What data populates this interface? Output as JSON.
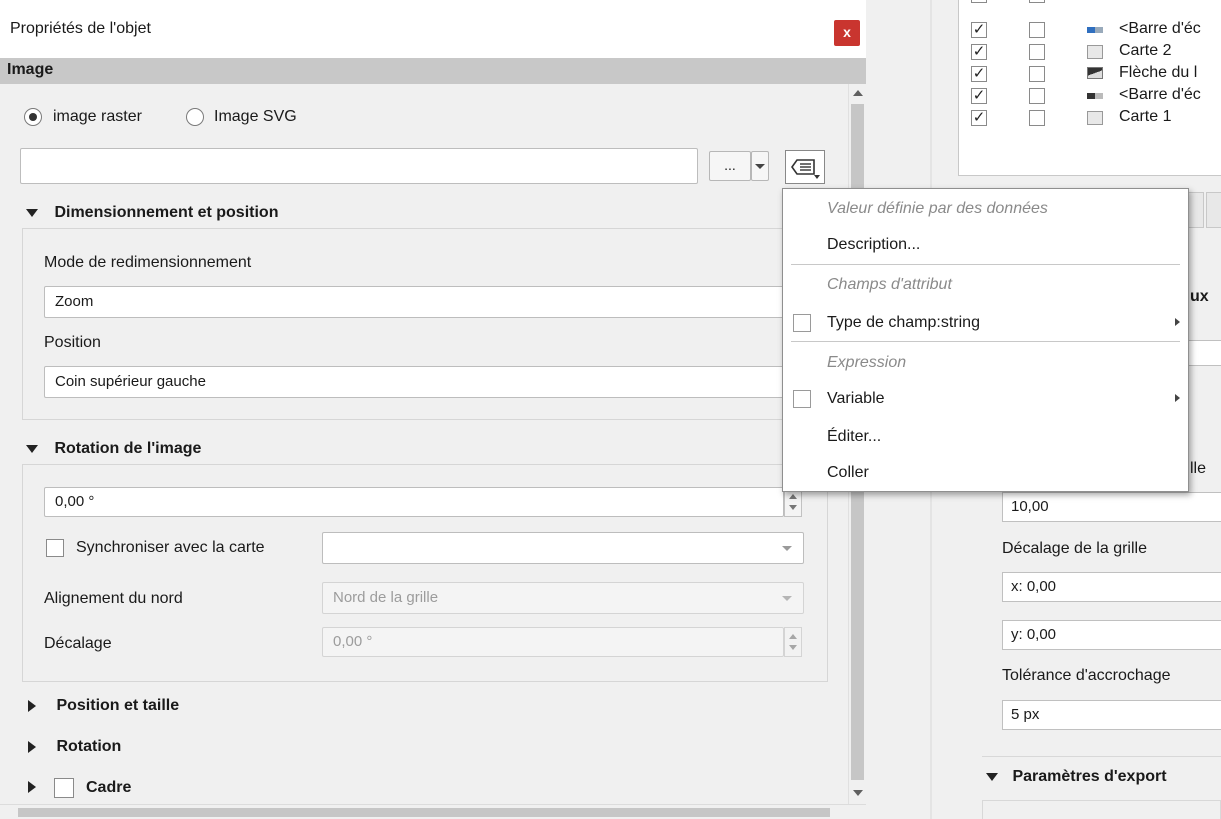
{
  "dialog": {
    "title": "Propriétés de l'objet",
    "close_label": "x",
    "section_title": "Image",
    "radio": {
      "raster_label": "image raster",
      "svg_label": "Image SVG"
    },
    "path_value": "",
    "browse_label": "...",
    "sizing_group": {
      "title": "Dimensionnement et position",
      "resize_mode_label": "Mode de redimensionnement",
      "resize_mode_value": "Zoom",
      "position_label": "Position",
      "position_value": "Coin supérieur gauche"
    },
    "rotation_group": {
      "title": "Rotation de l'image",
      "rotation_value": "0,00 °",
      "sync_label": "Synchroniser avec la carte",
      "sync_value": "",
      "north_label": "Alignement du nord",
      "north_value": "Nord de la grille",
      "offset_label": "Décalage",
      "offset_value": "0,00 °"
    },
    "collapsed_groups": {
      "position_size": "Position et taille",
      "rotation": "Rotation",
      "frame": "Cadre"
    }
  },
  "context_menu": {
    "header_data": "Valeur définie par des données",
    "description": "Description...",
    "header_fields": "Champs d'attribut",
    "field_type": "Type de champ:string",
    "header_expression": "Expression",
    "variable": "Variable",
    "edit": "Éditer...",
    "paste": "Coller"
  },
  "right_panel": {
    "items": [
      {
        "label": "<Barre d'éc"
      },
      {
        "label": "Carte 2"
      },
      {
        "label": "Flèche du l"
      },
      {
        "label": "<Barre d'éc"
      },
      {
        "label": "Carte 1"
      }
    ],
    "partial_label_1": "ux",
    "partial_label_2": "lle",
    "grid_spacing_value": "10,00",
    "grid_offset_label": "Décalage de la grille",
    "grid_offset_x": "x: 0,00",
    "grid_offset_y": "y: 0,00",
    "snap_tolerance_label": "Tolérance d'accrochage",
    "snap_tolerance_value": "5 px",
    "export_group_title": "Paramètres d'export",
    "check_mark": "✓"
  }
}
